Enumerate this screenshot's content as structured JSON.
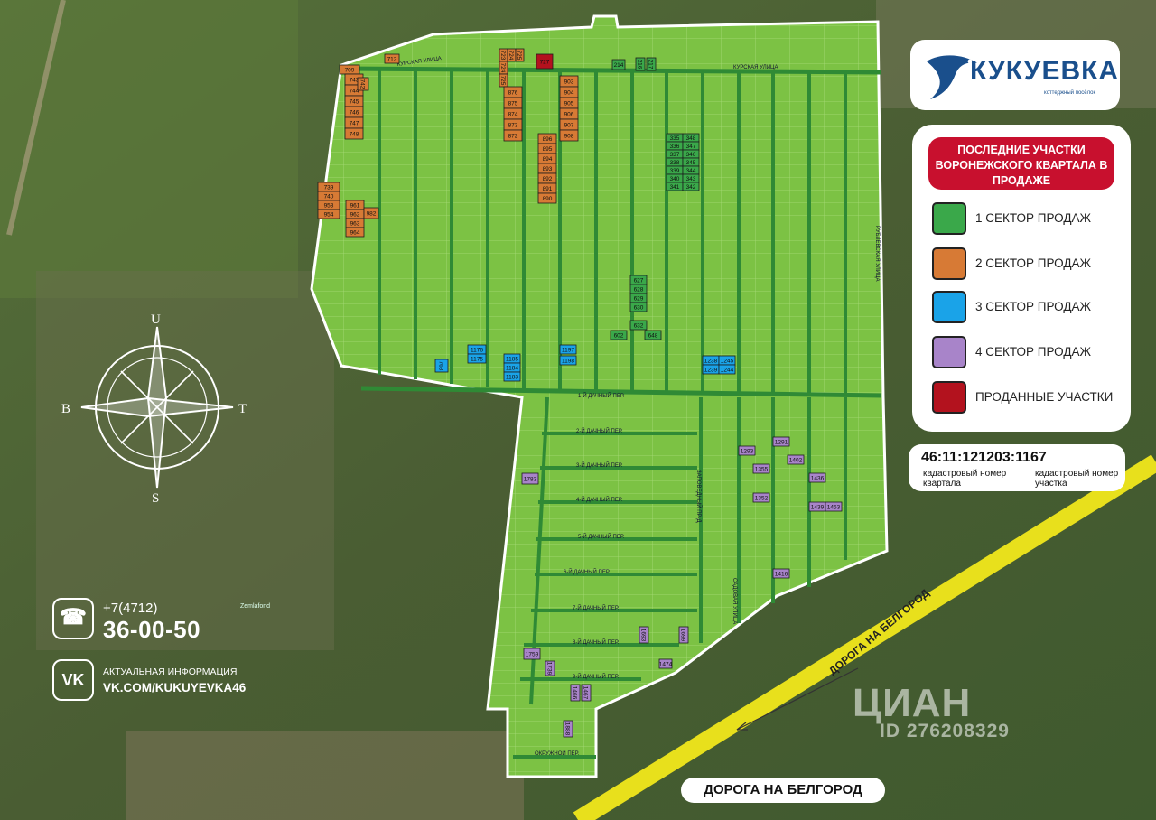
{
  "brand": {
    "name": "КУКУЕВКА",
    "tagline": "коттеджный посёлок"
  },
  "legend": {
    "title": "ПОСЛЕДНИЕ УЧАСТКИ ВОРОНЕЖСКОГО КВАРТАЛА В ПРОДАЖЕ",
    "items": [
      {
        "label": "1 СЕКТОР ПРОДАЖ",
        "color": "#3aa84a"
      },
      {
        "label": "2 СЕКТОР ПРОДАЖ",
        "color": "#d77a35"
      },
      {
        "label": "3 СЕКТОР ПРОДАЖ",
        "color": "#1aa3e8"
      },
      {
        "label": "4 СЕКТОР ПРОДАЖ",
        "color": "#a884c9"
      },
      {
        "label": "ПРОДАННЫЕ УЧАСТКИ",
        "color": "#b3121e"
      }
    ]
  },
  "cadastral": {
    "number": "46:11:121203:1167",
    "quarter_label": "кадастровый номер квартала",
    "plot_label": "кадастровый номер участка"
  },
  "contacts": {
    "phone_prefix": "+7(4712)",
    "phone_number": "36-00-50",
    "partner": "Zemlafond",
    "info_label": "АКТУАЛЬНАЯ ИНФОРМАЦИЯ",
    "vk_link": "VK.COM/KUKUYEVKA46"
  },
  "compass": {
    "n": "U",
    "w": "B",
    "e": "T",
    "s": "S"
  },
  "road": {
    "label": "ДОРОГА НА БЕЛГОРОД",
    "sign": "ДОРОГА НА БЕЛГОРОД"
  },
  "watermark": {
    "brand": "ЦИАН",
    "id": "ID 276208329"
  },
  "streets": {
    "kurskaya": "КУРСКАЯ УЛИЦА",
    "rubleskaya": "РУБЛЕВСКАЯ УЛИЦА",
    "lane1": "1-Й ДАЧНЫЙ ПЕР.",
    "lane2": "2-Й ДАЧНЫЙ ПЕР.",
    "lane3": "3-Й ДАЧНЫЙ ПЕР.",
    "lane4": "4-Й ДАЧНЫЙ ПЕР.",
    "lane5": "5-Й ДАЧНЫЙ ПЕР.",
    "lane6": "6-Й ДАЧНЫЙ ПЕР.",
    "lane7": "7-Й ДАЧНЫЙ ПЕР.",
    "lane8": "8-Й ДАЧНЫЙ ПЕР.",
    "lane9": "9-Й ДАЧНЫЙ ПЕР.",
    "okruzhnoy": "ОКРУЖНОЙ ПЕР.",
    "zapovednik": "ЗАПОВЕДНЫЙ ПР-Д",
    "sadovaya": "САДОВАЯ УЛИЦА"
  },
  "plots": {
    "orange_top": [
      "709",
      "712",
      "723",
      "724",
      "725"
    ],
    "orange_left": [
      "743",
      "744",
      "745",
      "746",
      "747",
      "748",
      "742"
    ],
    "orange_col2": [
      "876",
      "875",
      "874",
      "873",
      "872"
    ],
    "orange_col3": [
      "903",
      "904",
      "905",
      "906",
      "907",
      "908"
    ],
    "orange_col4": [
      "896",
      "895",
      "894",
      "893",
      "892",
      "891",
      "890"
    ],
    "orange_low": [
      "739",
      "740",
      "953",
      "954",
      "961",
      "962",
      "963",
      "964",
      "982"
    ],
    "sold": [
      "727"
    ],
    "green_top": [
      "214",
      "216",
      "217"
    ],
    "green_block_a": [
      "335",
      "336",
      "337",
      "338",
      "339",
      "340",
      "341"
    ],
    "green_block_b": [
      "348",
      "347",
      "346",
      "345",
      "344",
      "343",
      "342"
    ],
    "green_mid": [
      "627",
      "628",
      "629",
      "630",
      "632",
      "602",
      "648"
    ],
    "blue": [
      "1176",
      "1175",
      "1185",
      "1184",
      "1183",
      "1197",
      "1198",
      "1238",
      "1245",
      "1239",
      "1244",
      "763"
    ],
    "purple": [
      "1783",
      "1759",
      "1739",
      "1293",
      "1291",
      "1355",
      "1352",
      "1402",
      "1436",
      "1439",
      "1453",
      "1416",
      "1466",
      "1467",
      "1693",
      "1699",
      "1474",
      "1888"
    ]
  }
}
